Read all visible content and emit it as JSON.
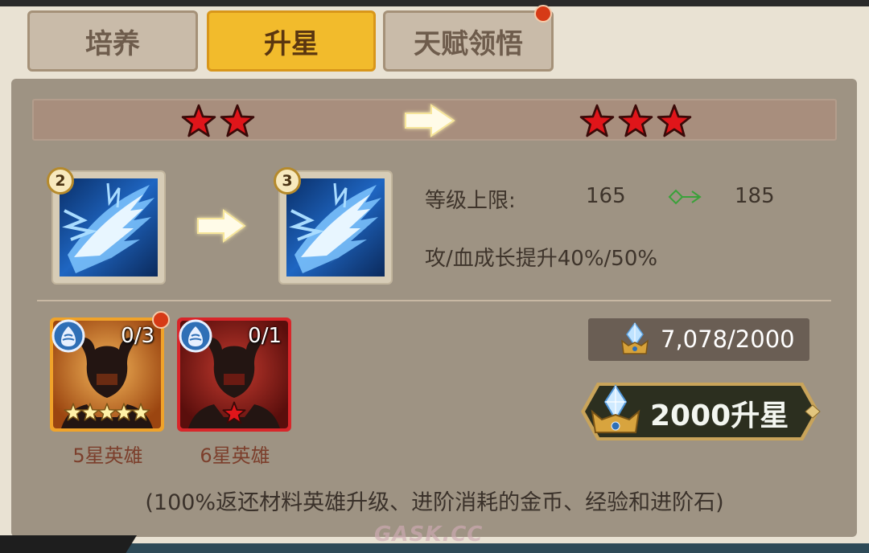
{
  "tabs": [
    {
      "label": "培养",
      "active": false
    },
    {
      "label": "升星",
      "active": true
    },
    {
      "label": "天赋领悟",
      "active": false,
      "badge": "red-dot"
    }
  ],
  "star_upgrade": {
    "from_stars": 2,
    "to_stars": 3,
    "star_color": "#e0151a"
  },
  "skill": {
    "from_level": "2",
    "to_level": "3",
    "icon": "blue-lightning-slash-icon"
  },
  "stats": {
    "level_cap_label": "等级上限:",
    "level_cap_from": "165",
    "level_cap_to": "185",
    "growth_text": "攻/血成长提升40%/50%"
  },
  "materials": [
    {
      "count": "0/3",
      "label": "5星英雄",
      "stars": 5,
      "frame_color": "#f0a32a",
      "badge": "red-dot"
    },
    {
      "count": "0/1",
      "label": "6星英雄",
      "stars": 1,
      "frame_color": "#d8262a"
    }
  ],
  "cost": {
    "value": "7,078/2000",
    "icon": "crystal-crown-icon"
  },
  "upgrade_button": {
    "label": "2000升星"
  },
  "note": "(100%返还材料英雄升级、进阶消耗的金币、经验和进阶石)",
  "watermark": "GASK.CC"
}
